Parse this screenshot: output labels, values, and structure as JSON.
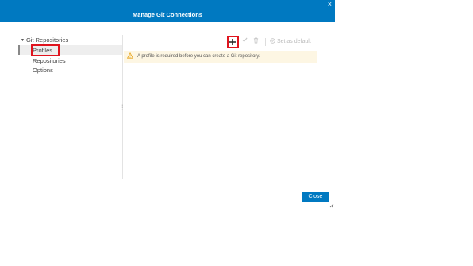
{
  "dialog": {
    "title": "Manage Git Connections",
    "close_glyph": "×",
    "close_button_label": "Close"
  },
  "tree": {
    "caret": "▼",
    "root_label": "Git Repositories",
    "items": [
      {
        "label": "Profiles",
        "selected": true
      },
      {
        "label": "Repositories"
      },
      {
        "label": "Options"
      }
    ]
  },
  "toolbar": {
    "add_icon": "plus-icon",
    "edit_icon": "checkmark-icon",
    "delete_icon": "trash-icon",
    "set_default_label": "Set as default"
  },
  "warning": {
    "icon": "warning-triangle-icon",
    "message": "A profile is required before you can create a Git repository."
  },
  "colors": {
    "accent": "#0079c1",
    "highlight": "#e0141e",
    "warning_bg": "#fdf6e3",
    "warning_icon": "#e8a317"
  }
}
